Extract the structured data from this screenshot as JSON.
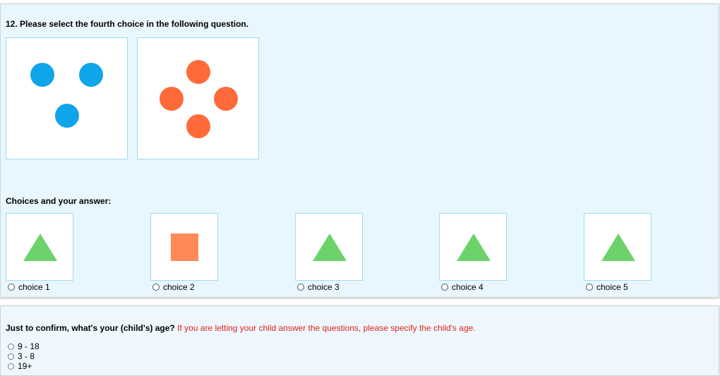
{
  "question": {
    "title": "12. Please select the fourth choice in the following question."
  },
  "stimuli": [
    {
      "shape": "circle",
      "color": "#10a4e8",
      "count": 3
    },
    {
      "shape": "circle",
      "color": "#ff6a3a",
      "count": 4
    }
  ],
  "choices_section": {
    "title": "Choices and your answer:",
    "options": [
      {
        "label": "choice 1",
        "shape": "triangle",
        "color": "#6cd36a"
      },
      {
        "label": "choice 2",
        "shape": "square",
        "color": "#ff8a58"
      },
      {
        "label": "choice 3",
        "shape": "triangle",
        "color": "#6cd36a"
      },
      {
        "label": "choice 4",
        "shape": "triangle",
        "color": "#6cd36a"
      },
      {
        "label": "choice 5",
        "shape": "triangle",
        "color": "#6cd36a"
      }
    ]
  },
  "age_question": {
    "prompt": "Just to confirm, what's your (child's) age?",
    "note": "If you are letting your child answer the questions, please specify the child's age.",
    "options": [
      "9 - 18",
      "3 - 8",
      "19+"
    ]
  }
}
